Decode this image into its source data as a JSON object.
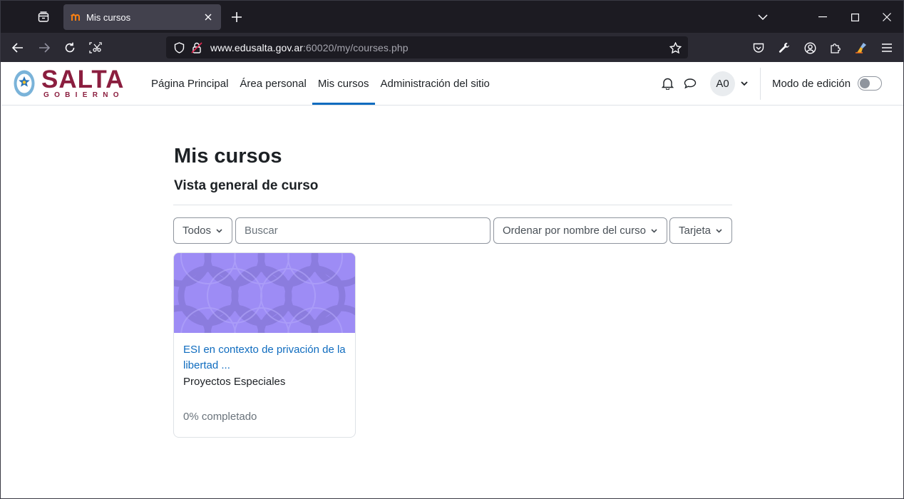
{
  "browser": {
    "tab_title": "Mis cursos",
    "url_host": "www.edusalta.gov.ar",
    "url_rest": ":60020/my/courses.php"
  },
  "site": {
    "logo_text": "SALTA",
    "logo_subtext": "GOBIERNO",
    "nav": [
      {
        "label": "Página Principal"
      },
      {
        "label": "Área personal"
      },
      {
        "label": "Mis cursos"
      },
      {
        "label": "Administración del sitio"
      }
    ],
    "user_initials": "A0",
    "edit_mode_label": "Modo de edición",
    "edit_mode_on": false
  },
  "main": {
    "title": "Mis cursos",
    "block_title": "Vista general de curso",
    "filter_label": "Todos",
    "search_placeholder": "Buscar",
    "sort_label": "Ordenar por nombre del curso",
    "view_label": "Tarjeta",
    "courses": [
      {
        "name": "ESI en contexto de privación de la libertad ...",
        "category": "Proyectos Especiales",
        "progress_text": "0% completado",
        "progress": 0
      }
    ]
  },
  "colors": {
    "brand": "#8b1e3f",
    "link": "#0f6cbf",
    "course_image": "#9d8cf5"
  }
}
